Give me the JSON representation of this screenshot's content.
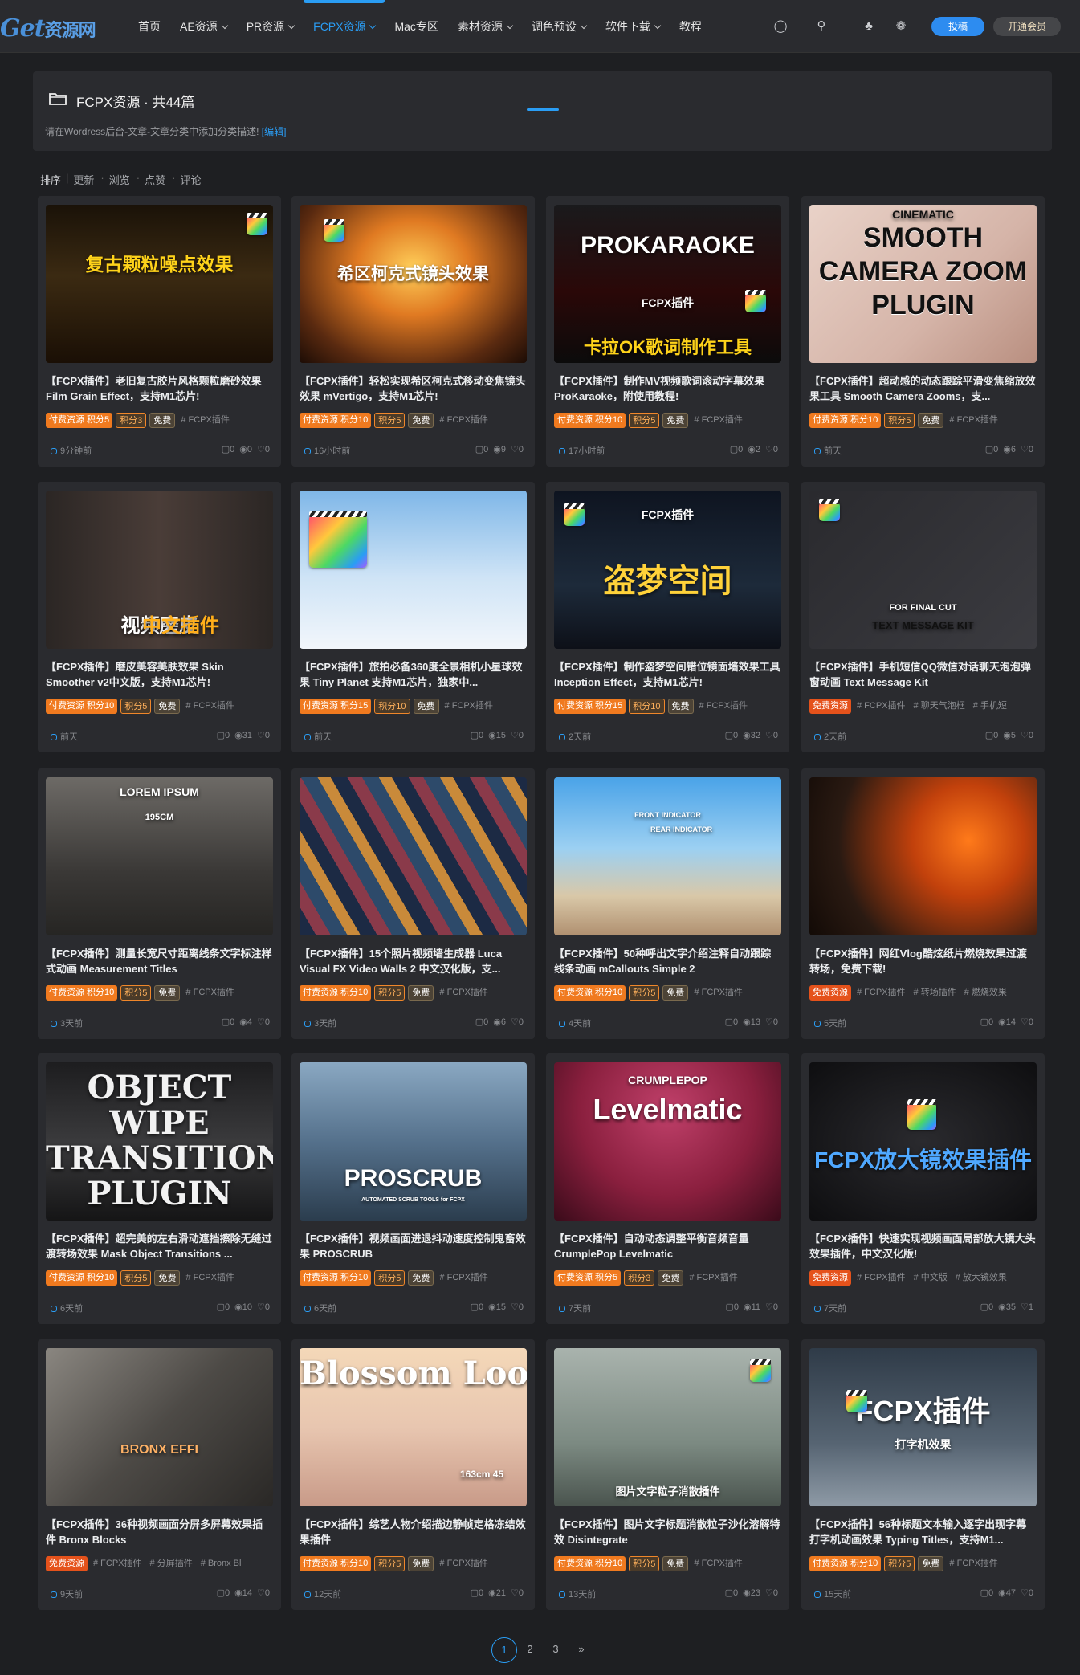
{
  "site": {
    "logo_text": "Get",
    "logo_sub": "资源网"
  },
  "nav": [
    {
      "label": "首页",
      "has_menu": false,
      "active": false
    },
    {
      "label": "AE资源",
      "has_menu": true,
      "active": false
    },
    {
      "label": "PR资源",
      "has_menu": true,
      "active": false
    },
    {
      "label": "FCPX资源",
      "has_menu": true,
      "active": true
    },
    {
      "label": "Mac专区",
      "has_menu": false,
      "active": false
    },
    {
      "label": "素材资源",
      "has_menu": true,
      "active": false
    },
    {
      "label": "调色预设",
      "has_menu": true,
      "active": false
    },
    {
      "label": "软件下载",
      "has_menu": true,
      "active": false
    },
    {
      "label": "教程",
      "has_menu": false,
      "active": false
    }
  ],
  "header_actions": {
    "contribute": "投稿",
    "vip": "开通会员"
  },
  "category": {
    "title": "FCPX资源",
    "count": "共44篇",
    "desc": "请在Wordress后台-文章-文章分类中添加分类描述!",
    "edit": "[编辑]"
  },
  "sort": [
    "排序",
    "更新",
    "浏览",
    "点赞",
    "评论"
  ],
  "cards": [
    {
      "title": "【FCPX插件】老旧复古胶片风格颗粒磨砂效果 Film Grain Effect，支持M1芯片!",
      "tags": [
        {
          "k": "paid",
          "t": "付费资源 积分5"
        },
        {
          "k": "pts",
          "t": "积分3"
        },
        {
          "k": "frv",
          "t": "免费"
        },
        {
          "k": "txt",
          "t": "# FCPX插件"
        }
      ],
      "time": "9分钟前",
      "c": "0",
      "v": "0",
      "l": "0",
      "thumb": "复古颗粒噪点效果"
    },
    {
      "title": "【FCPX插件】轻松实现希区柯克式移动变焦镜头效果 mVertigo，支持M1芯片!",
      "tags": [
        {
          "k": "paid",
          "t": "付费资源 积分10"
        },
        {
          "k": "pts",
          "t": "积分5"
        },
        {
          "k": "frv",
          "t": "免费"
        },
        {
          "k": "txt",
          "t": "# FCPX插件"
        }
      ],
      "time": "16小时前",
      "c": "0",
      "v": "9",
      "l": "0",
      "thumb": "希区柯克式镜头效果"
    },
    {
      "title": "【FCPX插件】制作MV视频歌词滚动字幕效果 ProKaraoke，附使用教程!",
      "tags": [
        {
          "k": "paid",
          "t": "付费资源 积分10"
        },
        {
          "k": "pts",
          "t": "积分5"
        },
        {
          "k": "frv",
          "t": "免费"
        },
        {
          "k": "txt",
          "t": "# FCPX插件"
        }
      ],
      "time": "17小时前",
      "c": "0",
      "v": "2",
      "l": "0",
      "thumb": "PROKARAOKE",
      "thumb_sub": "FCPX插件",
      "thumb_sub2": "卡拉OK歌词制作工具"
    },
    {
      "title": "【FCPX插件】超动感的动态跟踪平滑变焦缩放效果工具 Smooth Camera Zooms，支...",
      "tags": [
        {
          "k": "paid",
          "t": "付费资源 积分10"
        },
        {
          "k": "pts",
          "t": "积分5"
        },
        {
          "k": "frv",
          "t": "免费"
        },
        {
          "k": "txt",
          "t": "# FCPX插件"
        }
      ],
      "time": "前天",
      "c": "0",
      "v": "6",
      "l": "0",
      "thumb": "SMOOTH CAMERA ZOOM PLUGIN",
      "thumb_sub": "CINEMATIC"
    },
    {
      "title": "【FCPX插件】磨皮美容美肤效果 Skin Smoother v2中文版，支持M1芯片!",
      "tags": [
        {
          "k": "paid",
          "t": "付费资源 积分10"
        },
        {
          "k": "pts",
          "t": "积分5"
        },
        {
          "k": "frv",
          "t": "免费"
        },
        {
          "k": "txt",
          "t": "# FCPX插件"
        }
      ],
      "time": "前天",
      "c": "0",
      "v": "31",
      "l": "0",
      "thumb": "视频磨皮",
      "thumb_sub": "中文插件"
    },
    {
      "title": "【FCPX插件】旅拍必备360度全景相机小星球效果 Tiny Planet 支持M1芯片，独家中...",
      "tags": [
        {
          "k": "paid",
          "t": "付费资源 积分15"
        },
        {
          "k": "pts",
          "t": "积分10"
        },
        {
          "k": "frv",
          "t": "免费"
        },
        {
          "k": "txt",
          "t": "# FCPX插件"
        }
      ],
      "time": "前天",
      "c": "0",
      "v": "15",
      "l": "0",
      "thumb": ""
    },
    {
      "title": "【FCPX插件】制作盗梦空间错位镜面墙效果工具 Inception Effect，支持M1芯片!",
      "tags": [
        {
          "k": "paid",
          "t": "付费资源 积分15"
        },
        {
          "k": "pts",
          "t": "积分10"
        },
        {
          "k": "frv",
          "t": "免费"
        },
        {
          "k": "txt",
          "t": "# FCPX插件"
        }
      ],
      "time": "2天前",
      "c": "0",
      "v": "32",
      "l": "0",
      "thumb": "盗梦空间",
      "thumb_sub": "FCPX插件"
    },
    {
      "title": "【FCPX插件】手机短信QQ微信对话聊天泡泡弹窗动画 Text Message Kit",
      "tags": [
        {
          "k": "free",
          "t": "免费资源"
        },
        {
          "k": "txt",
          "t": "# FCPX插件"
        },
        {
          "k": "txt",
          "t": "# 聊天气泡框"
        },
        {
          "k": "txt",
          "t": "# 手机短"
        }
      ],
      "time": "2天前",
      "c": "0",
      "v": "5",
      "l": "0",
      "thumb": "TEXT MESSAGE KIT",
      "thumb_sub": "FOR FINAL CUT"
    },
    {
      "title": "【FCPX插件】测量长宽尺寸距离线条文字标注样式动画 Measurement Titles",
      "tags": [
        {
          "k": "paid",
          "t": "付费资源 积分10"
        },
        {
          "k": "pts",
          "t": "积分5"
        },
        {
          "k": "frv",
          "t": "免费"
        },
        {
          "k": "txt",
          "t": "# FCPX插件"
        }
      ],
      "time": "3天前",
      "c": "0",
      "v": "4",
      "l": "0",
      "thumb": "195CM",
      "thumb_sub": "LOREM IPSUM"
    },
    {
      "title": "【FCPX插件】15个照片视频墙生成器 Luca Visual FX Video Walls 2 中文汉化版，支...",
      "tags": [
        {
          "k": "paid",
          "t": "付费资源 积分10"
        },
        {
          "k": "pts",
          "t": "积分5"
        },
        {
          "k": "frv",
          "t": "免费"
        },
        {
          "k": "txt",
          "t": "# FCPX插件"
        }
      ],
      "time": "3天前",
      "c": "0",
      "v": "6",
      "l": "0",
      "thumb": ""
    },
    {
      "title": "【FCPX插件】50种呼出文字介绍注释自动跟踪线条动画 mCallouts Simple 2",
      "tags": [
        {
          "k": "paid",
          "t": "付费资源 积分10"
        },
        {
          "k": "pts",
          "t": "积分5"
        },
        {
          "k": "frv",
          "t": "免费"
        },
        {
          "k": "txt",
          "t": "# FCPX插件"
        }
      ],
      "time": "4天前",
      "c": "0",
      "v": "13",
      "l": "0",
      "thumb": "FRONT INDICATOR",
      "thumb_sub": "REAR INDICATOR"
    },
    {
      "title": "【FCPX插件】网红Vlog酷炫纸片燃烧效果过渡转场，免费下载!",
      "tags": [
        {
          "k": "free",
          "t": "免费资源"
        },
        {
          "k": "txt",
          "t": "# FCPX插件"
        },
        {
          "k": "txt",
          "t": "# 转场插件"
        },
        {
          "k": "txt",
          "t": "# 燃烧效果"
        }
      ],
      "time": "5天前",
      "c": "0",
      "v": "14",
      "l": "0",
      "thumb": ""
    },
    {
      "title": "【FCPX插件】超完美的左右滑动遮挡擦除无缝过渡转场效果 Mask Object Transitions ...",
      "tags": [
        {
          "k": "paid",
          "t": "付费资源 积分10"
        },
        {
          "k": "pts",
          "t": "积分5"
        },
        {
          "k": "frv",
          "t": "免费"
        },
        {
          "k": "txt",
          "t": "# FCPX插件"
        }
      ],
      "time": "6天前",
      "c": "0",
      "v": "10",
      "l": "0",
      "thumb": "OBJECT WIPE TRANSITION PLUGIN"
    },
    {
      "title": "【FCPX插件】视频画面进退抖动速度控制鬼畜效果 PROSCRUB",
      "tags": [
        {
          "k": "paid",
          "t": "付费资源 积分10"
        },
        {
          "k": "pts",
          "t": "积分5"
        },
        {
          "k": "frv",
          "t": "免费"
        },
        {
          "k": "txt",
          "t": "# FCPX插件"
        }
      ],
      "time": "6天前",
      "c": "0",
      "v": "15",
      "l": "0",
      "thumb": "PROSCRUB",
      "thumb_sub": "AUTOMATED SCRUB TOOLS for FCPX"
    },
    {
      "title": "【FCPX插件】自动动态调整平衡音频音量 CrumplePop Levelmatic",
      "tags": [
        {
          "k": "paid",
          "t": "付费资源 积分5"
        },
        {
          "k": "pts",
          "t": "积分3"
        },
        {
          "k": "frv",
          "t": "免费"
        },
        {
          "k": "txt",
          "t": "# FCPX插件"
        }
      ],
      "time": "7天前",
      "c": "0",
      "v": "11",
      "l": "0",
      "thumb": "Levelmatic",
      "thumb_sub": "CRUMPLEPOP"
    },
    {
      "title": "【FCPX插件】快速实现视频画面局部放大镜大头效果插件，中文汉化版!",
      "tags": [
        {
          "k": "free",
          "t": "免费资源"
        },
        {
          "k": "txt",
          "t": "# FCPX插件"
        },
        {
          "k": "txt",
          "t": "# 中文版"
        },
        {
          "k": "txt",
          "t": "# 放大镜效果"
        }
      ],
      "time": "7天前",
      "c": "0",
      "v": "35",
      "l": "1",
      "thumb": "FCPX放大镜效果插件"
    },
    {
      "title": "【FCPX插件】36种视频画面分屏多屏幕效果插件 Bronx Blocks",
      "tags": [
        {
          "k": "free",
          "t": "免费资源"
        },
        {
          "k": "txt",
          "t": "# FCPX插件"
        },
        {
          "k": "txt",
          "t": "# 分屏插件"
        },
        {
          "k": "txt",
          "t": "# Bronx Bl"
        }
      ],
      "time": "9天前",
      "c": "0",
      "v": "14",
      "l": "0",
      "thumb": "BRONX EFFI"
    },
    {
      "title": "【FCPX插件】综艺人物介绍描边静帧定格冻结效果插件",
      "tags": [
        {
          "k": "paid",
          "t": "付费资源 积分10"
        },
        {
          "k": "pts",
          "t": "积分5"
        },
        {
          "k": "frv",
          "t": "免费"
        },
        {
          "k": "txt",
          "t": "# FCPX插件"
        }
      ],
      "time": "12天前",
      "c": "0",
      "v": "21",
      "l": "0",
      "thumb": "Blossom Lookboo",
      "thumb_sub": "163cm 45"
    },
    {
      "title": "【FCPX插件】图片文字标题消散粒子沙化溶解特效 Disintegrate",
      "tags": [
        {
          "k": "paid",
          "t": "付费资源 积分10"
        },
        {
          "k": "pts",
          "t": "积分5"
        },
        {
          "k": "frv",
          "t": "免费"
        },
        {
          "k": "txt",
          "t": "# FCPX插件"
        }
      ],
      "time": "13天前",
      "c": "0",
      "v": "23",
      "l": "0",
      "thumb": "图片文字粒子消散插件"
    },
    {
      "title": "【FCPX插件】56种标题文本输入逐字出现字幕打字机动画效果 Typing Titles，支持M1...",
      "tags": [
        {
          "k": "paid",
          "t": "付费资源 积分10"
        },
        {
          "k": "pts",
          "t": "积分5"
        },
        {
          "k": "frv",
          "t": "免费"
        },
        {
          "k": "txt",
          "t": "# FCPX插件"
        }
      ],
      "time": "15天前",
      "c": "0",
      "v": "47",
      "l": "0",
      "thumb": "FCPX插件",
      "thumb_sub": "打字机效果"
    }
  ],
  "pager": [
    "1",
    "2",
    "3",
    "»"
  ],
  "colors": {
    "accent": "#2a9df4",
    "bg": "#1e1f22",
    "card": "#2a2b2f",
    "paid": "#f07a1f"
  }
}
